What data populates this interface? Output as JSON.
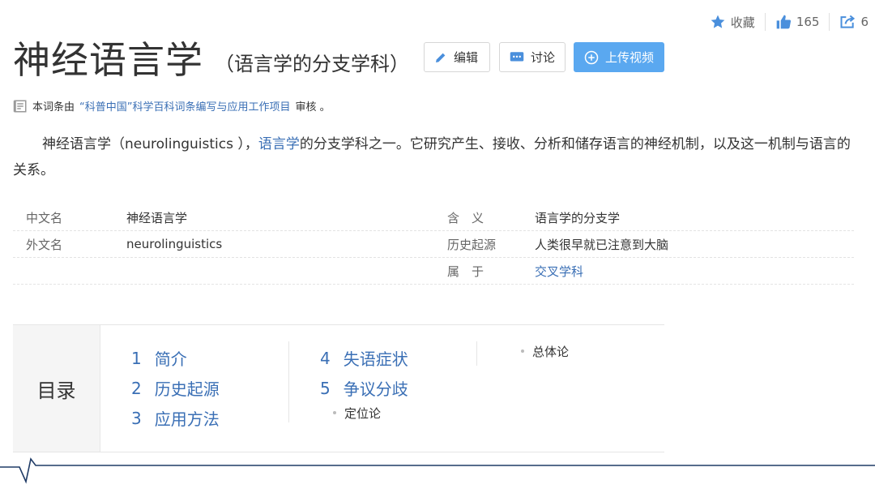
{
  "actions": {
    "collect": "收藏",
    "like_count": "165",
    "share_count": "6"
  },
  "title": {
    "main": "神经语言学",
    "sub": "（语言学的分支学科）"
  },
  "buttons": {
    "edit": "编辑",
    "discuss": "讨论",
    "upload_video": "上传视频"
  },
  "review": {
    "prefix": "本词条由",
    "org": "“科普中国”科学百科词条编写与应用工作项目",
    "suffix": "审核 。"
  },
  "summary": {
    "part1": "神经语言学（neurolinguistics ），",
    "link": "语言学",
    "part2": "的分支学科之一。它研究产生、接收、分析和储存语言的神经机制，以及这一机制与语言的关系。"
  },
  "info": [
    {
      "k": "中文名",
      "v": "神经语言学",
      "k2": "含　义",
      "v2": "语言学的分支学"
    },
    {
      "k": "外文名",
      "v": "neurolinguistics",
      "k2": "历史起源",
      "v2": "人类很早就已注意到大脑"
    },
    {
      "k": "",
      "v": "",
      "k2": "属　于",
      "v2": "交叉学科"
    }
  ],
  "toc": {
    "heading": "目录",
    "items": [
      {
        "num": "1",
        "label": "简介"
      },
      {
        "num": "2",
        "label": "历史起源"
      },
      {
        "num": "3",
        "label": "应用方法"
      },
      {
        "num": "4",
        "label": "失语症状"
      },
      {
        "num": "5",
        "label": "争议分歧"
      }
    ],
    "subs": [
      "定位论",
      "总体论"
    ]
  },
  "colors": {
    "link": "#3a6fb5",
    "accent": "#5aa8f0",
    "icon_blue": "#4a8fdc"
  },
  "icons": [
    "star-icon",
    "thumbs-up-icon",
    "share-icon",
    "pencil-icon",
    "chat-icon",
    "plus-circle-icon",
    "document-icon"
  ]
}
